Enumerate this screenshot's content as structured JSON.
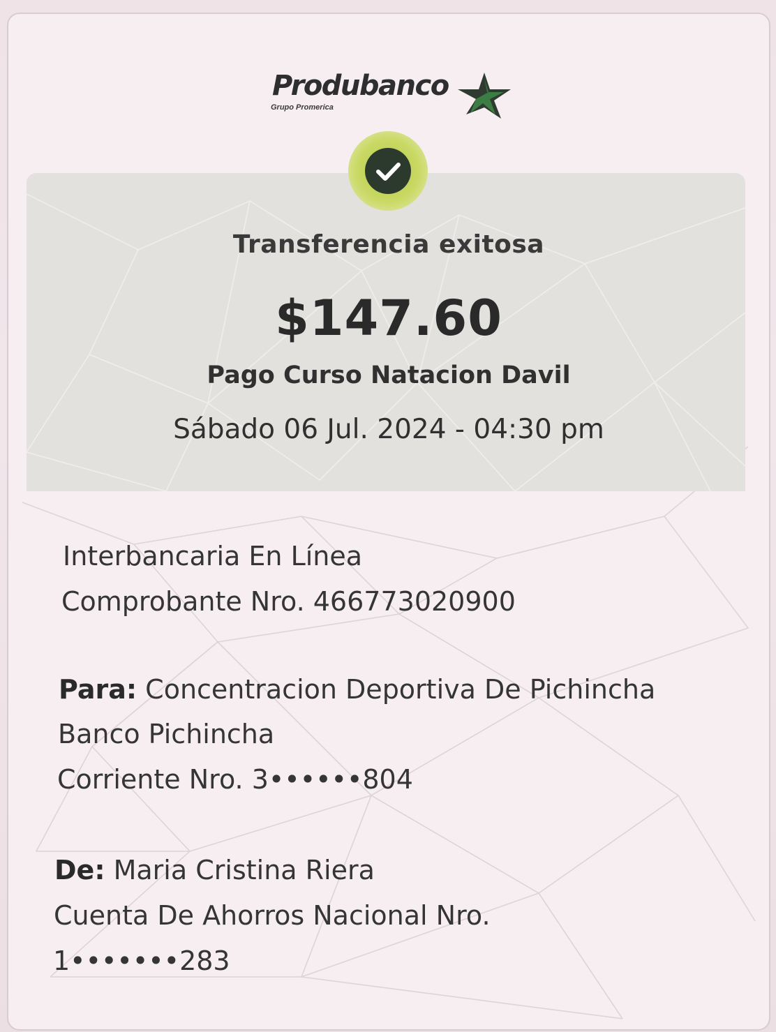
{
  "bank": {
    "name": "Produbanco",
    "group": "Grupo Promerica"
  },
  "receipt": {
    "status": "Transferencia exitosa",
    "amount": "$147.60",
    "concept": "Pago Curso Natacion Davil",
    "datetime": "Sábado 06 Jul. 2024 - 04:30 pm"
  },
  "details": {
    "transfer_type": "Interbancaria En Línea",
    "voucher": "Comprobante Nro. 466773020900"
  },
  "recipient": {
    "label": "Para:",
    "name": "Concentracion Deportiva De Pichincha",
    "bank": "Banco Pichincha",
    "account": "Corriente Nro. 3••••••804"
  },
  "sender": {
    "label": "De:",
    "name": "Maria Cristina Riera",
    "account_type": "Cuenta De Ahorros Nacional Nro.",
    "account_number": "1•••••••283"
  },
  "colors": {
    "brand_green": "#2f8a3c",
    "check_ring": "#c9d964",
    "check_fill": "#2b3a2c",
    "summary_bg": "#e3e1de"
  },
  "icons": {
    "success": "check-circle-icon",
    "logo_star": "star-logo-icon"
  }
}
